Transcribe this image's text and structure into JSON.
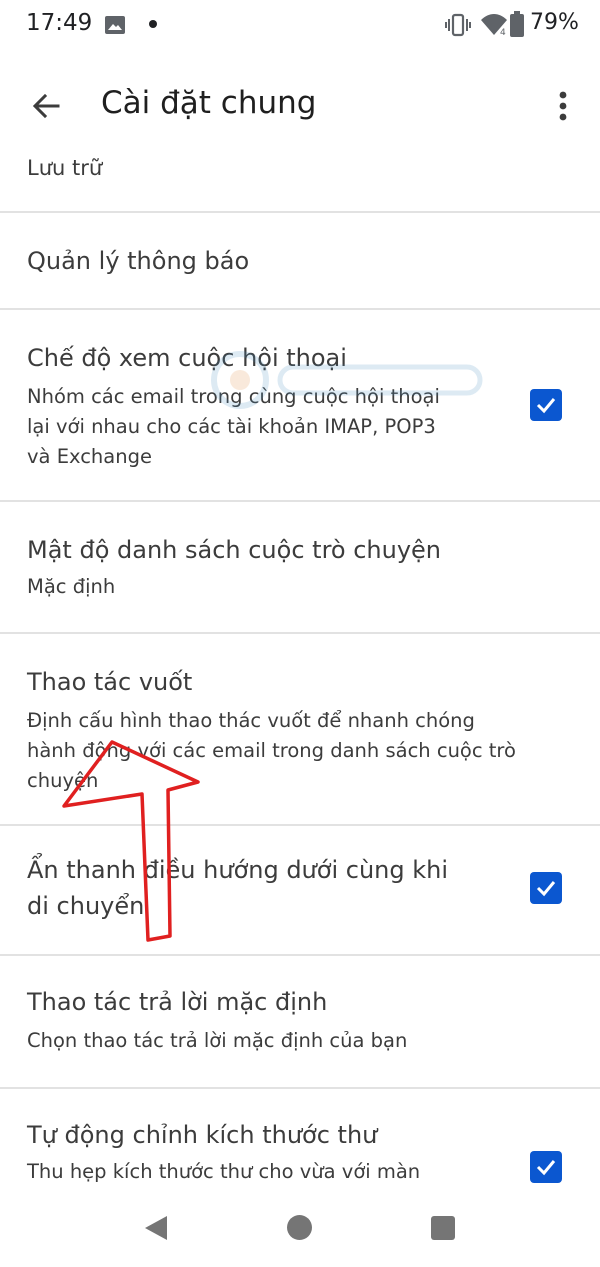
{
  "status_bar": {
    "time": "17:49",
    "battery": "79%",
    "network_badge": "4",
    "icons": [
      "image-icon",
      "dot-icon",
      "vibrate-icon",
      "wifi-icon",
      "battery-icon"
    ]
  },
  "app_bar": {
    "title": "Cài đặt chung",
    "back_icon": "arrow-back-icon",
    "more_icon": "more-vert-icon"
  },
  "settings": {
    "storage": {
      "title": "Lưu trữ"
    },
    "notifications": {
      "title": "Quản lý thông báo"
    },
    "conversation_view": {
      "title": "Chế độ xem cuộc hội thoại",
      "subtitle_lines": [
        "Nhóm các email trong cùng cuộc hội thoại",
        "lại với nhau cho các tài khoản IMAP, POP3",
        "và Exchange"
      ],
      "checked": true
    },
    "list_density": {
      "title": "Mật độ danh sách cuộc trò chuyện",
      "subtitle": "Mặc định"
    },
    "swipe_actions": {
      "title": "Thao tác vuốt",
      "subtitle_lines": [
        "Định cấu hình thao thác vuốt để nhanh chóng",
        "hành động với các email trong danh sách cuộc trò",
        "chuyện"
      ]
    },
    "hide_bottom_nav": {
      "title_lines": [
        "Ẩn thanh điều hướng dưới cùng khi",
        "di chuyển"
      ],
      "checked": true
    },
    "default_reply": {
      "title": "Thao tác trả lời mặc định",
      "subtitle": "Chọn thao tác trả lời mặc định của bạn"
    },
    "auto_fit": {
      "title": "Tự động chỉnh kích thước thư",
      "subtitle": "Thu hẹp kích thước thư cho vừa với màn",
      "checked": true
    }
  },
  "nav_bar": {
    "icons": [
      "nav-back-icon",
      "nav-home-icon",
      "nav-recents-icon"
    ]
  },
  "colors": {
    "checkbox": "#0b57d0",
    "divider": "#e2e2e2",
    "annotation_arrow": "#e02020"
  }
}
